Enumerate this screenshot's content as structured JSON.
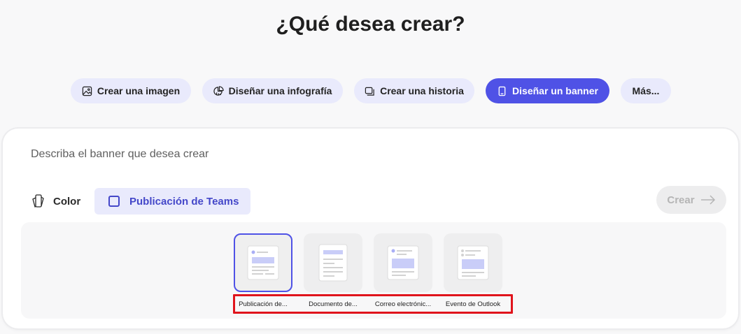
{
  "page": {
    "title": "¿Qué desea crear?"
  },
  "chips": [
    {
      "label": "Crear una imagen",
      "icon": "image-icon",
      "active": false
    },
    {
      "label": "Diseñar una infografía",
      "icon": "infographic-icon",
      "active": false
    },
    {
      "label": "Crear una historia",
      "icon": "story-icon",
      "active": false
    },
    {
      "label": "Diseñar un banner",
      "icon": "banner-icon",
      "active": true
    },
    {
      "label": "Más..."
    }
  ],
  "composer": {
    "prompt_placeholder": "Describa el banner que desea crear",
    "color_label": "Color",
    "format_label": "Publicación de Teams",
    "create_label": "Crear"
  },
  "templates": [
    {
      "label": "Publicación de...",
      "selected": true
    },
    {
      "label": "Documento de..."
    },
    {
      "label": "Correo electrónic..."
    },
    {
      "label": "Evento de Outlook"
    }
  ],
  "colors": {
    "accent": "#4f52e6",
    "chip_bg": "#e9eafc",
    "highlight": "#e0141c"
  }
}
